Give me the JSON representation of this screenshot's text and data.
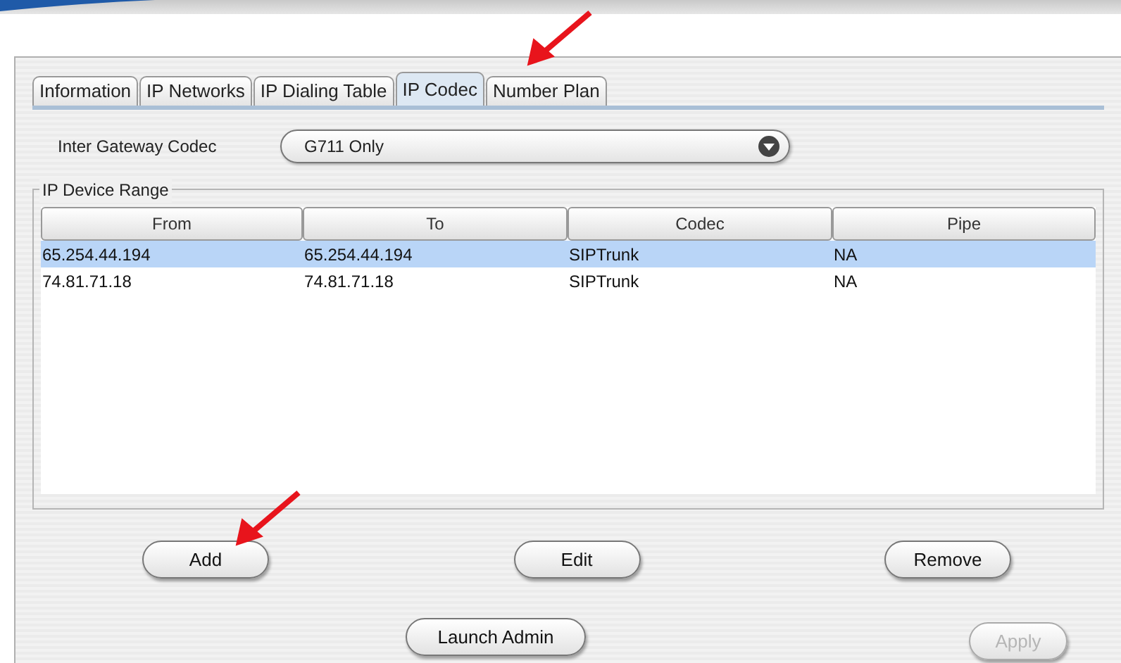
{
  "tabs": [
    {
      "label": "Information",
      "selected": false
    },
    {
      "label": "IP Networks",
      "selected": false
    },
    {
      "label": "IP Dialing Table",
      "selected": false
    },
    {
      "label": "IP Codec",
      "selected": true
    },
    {
      "label": "Number Plan",
      "selected": false
    }
  ],
  "codec_field": {
    "label": "Inter Gateway Codec",
    "value": "G711 Only"
  },
  "device_range": {
    "title": "IP Device Range",
    "columns": [
      "From",
      "To",
      "Codec",
      "Pipe"
    ],
    "rows": [
      {
        "cells": [
          "65.254.44.194",
          "65.254.44.194",
          "SIPTrunk",
          "NA"
        ],
        "selected": true
      },
      {
        "cells": [
          "74.81.71.18",
          "74.81.71.18",
          "SIPTrunk",
          "NA"
        ],
        "selected": false
      }
    ]
  },
  "row_buttons": [
    {
      "label": "Add",
      "disabled": false
    },
    {
      "label": "Edit",
      "disabled": false
    },
    {
      "label": "Remove",
      "disabled": false
    }
  ],
  "bottom_buttons": [
    {
      "label": "Launch Admin",
      "disabled": false
    },
    {
      "label": "Apply",
      "disabled": true
    }
  ]
}
